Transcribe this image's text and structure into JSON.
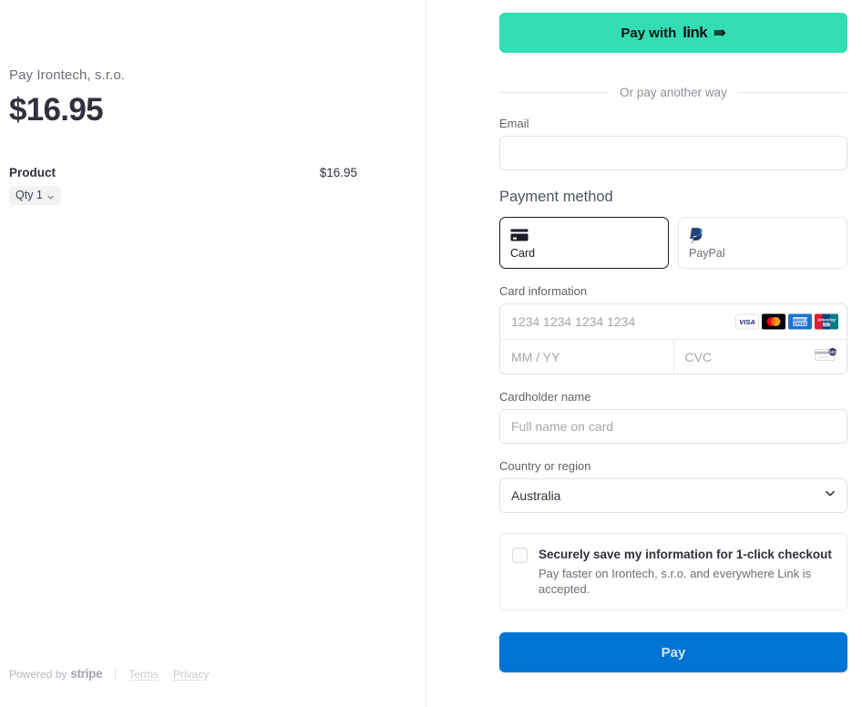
{
  "order_summary": {
    "merchant_line": "Pay Irontech, s.r.o.",
    "amount": "$16.95",
    "line_items": [
      {
        "name": "Product",
        "qty_label": "Qty 1",
        "price": "$16.95"
      }
    ]
  },
  "footer": {
    "powered_by": "Powered by",
    "brand": "stripe",
    "links": [
      {
        "label": "Terms"
      },
      {
        "label": "Privacy"
      }
    ]
  },
  "express_checkout": {
    "link_button": {
      "prefix": "Pay with",
      "brand": "link",
      "arrow": "⇛",
      "bg_color": "#33ddb3",
      "text_color": "#0e1114"
    },
    "divider_text": "Or pay another way"
  },
  "form": {
    "email": {
      "label": "Email",
      "value": "",
      "placeholder": ""
    },
    "payment_method": {
      "title": "Payment method",
      "tabs": [
        {
          "label": "Card",
          "icon": "credit-card-icon",
          "selected": true
        },
        {
          "label": "PayPal",
          "icon": "paypal-icon",
          "selected": false
        }
      ]
    },
    "card_information": {
      "label": "Card information",
      "number": {
        "placeholder": "1234 1234 1234 1234",
        "value": ""
      },
      "expiry": {
        "placeholder": "MM / YY",
        "value": ""
      },
      "cvc": {
        "placeholder": "CVC",
        "value": ""
      },
      "accepted_brands": [
        "visa",
        "mastercard",
        "amex",
        "unionpay"
      ],
      "cvc_hint_icon": "cvc-card-back-icon"
    },
    "cardholder_name": {
      "label": "Cardholder name",
      "placeholder": "Full name on card",
      "value": ""
    },
    "country": {
      "label": "Country or region",
      "selected": "Australia",
      "chevron_icon": "chevron-down-icon"
    },
    "save_info": {
      "checked": false,
      "title": "Securely save my information for 1-click checkout",
      "subtitle": "Pay faster on Irontech, s.r.o. and everywhere Link is accepted."
    },
    "submit": {
      "label": "Pay",
      "bg_color": "#0074d4"
    }
  }
}
